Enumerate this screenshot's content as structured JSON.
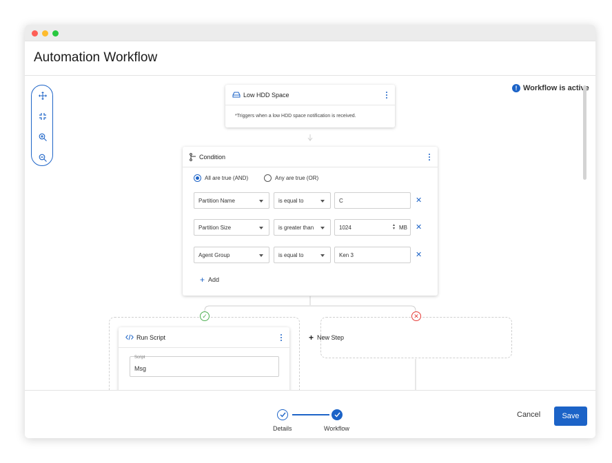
{
  "window": {
    "title": "Automation Workflow"
  },
  "status": {
    "text": "Workflow is active",
    "icon": "info-icon"
  },
  "toolbar": {
    "tools": [
      "move-icon",
      "fit-icon",
      "zoom-in-icon",
      "zoom-out-icon"
    ]
  },
  "trigger": {
    "title": "Low HDD Space",
    "description": "*Triggers when a low HDD space notification is received."
  },
  "condition": {
    "title": "Condition",
    "radio_and": "All are true (AND)",
    "radio_or": "Any are true (OR)",
    "rows": [
      {
        "field": "Partition Name",
        "operator": "is equal to",
        "value": "C",
        "unit": ""
      },
      {
        "field": "Partition Size",
        "operator": "is greater than",
        "value": "1024",
        "unit": "MB"
      },
      {
        "field": "Agent Group",
        "operator": "is equal to",
        "value": "Ken 3",
        "unit": ""
      }
    ],
    "add_label": "Add"
  },
  "run_script": {
    "title": "Run Script",
    "script_label": "Script",
    "script_value": "Msg"
  },
  "new_step": {
    "label": "New Step"
  },
  "footer": {
    "steps": [
      "Details",
      "Workflow"
    ],
    "cancel": "Cancel",
    "save": "Save"
  },
  "colors": {
    "accent": "#1c63c7",
    "success": "#4caf50",
    "danger": "#e53935"
  }
}
